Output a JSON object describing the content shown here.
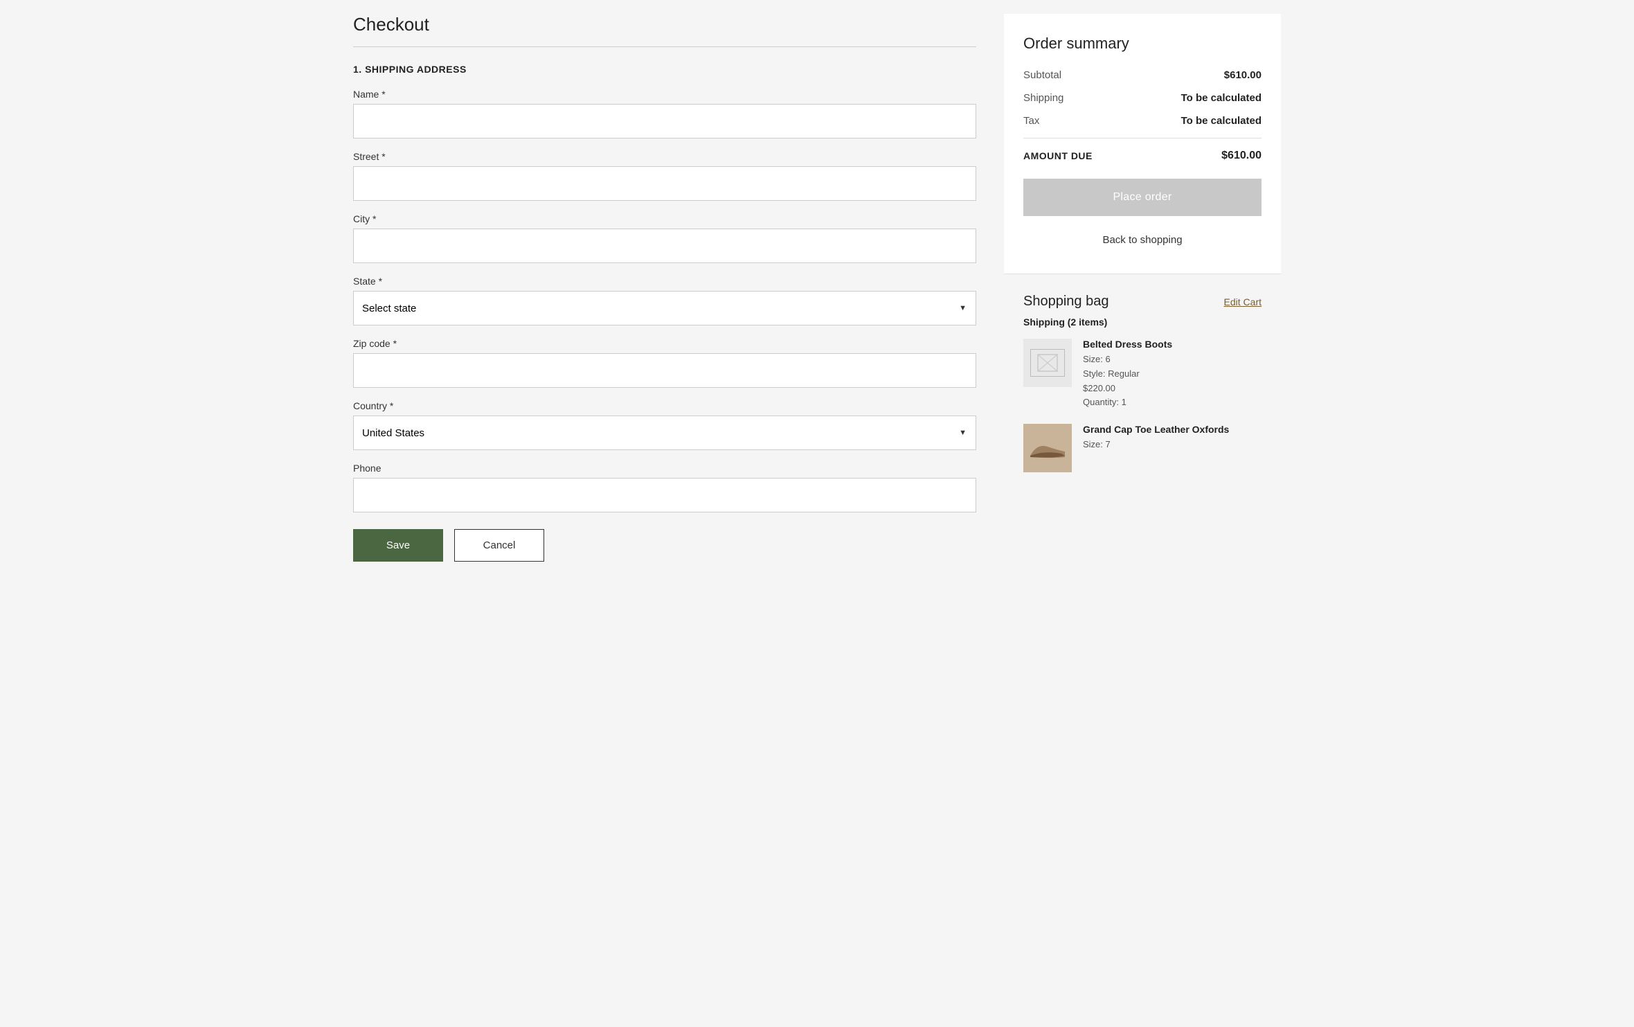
{
  "page": {
    "title": "Checkout"
  },
  "shipping_section": {
    "section_title": "1. SHIPPING ADDRESS",
    "fields": {
      "name": {
        "label": "Name *",
        "placeholder": "",
        "value": ""
      },
      "street": {
        "label": "Street *",
        "placeholder": "",
        "value": ""
      },
      "city": {
        "label": "City *",
        "placeholder": "",
        "value": ""
      },
      "state": {
        "label": "State *",
        "placeholder": "Select state",
        "value": ""
      },
      "zip": {
        "label": "Zip code *",
        "placeholder": "",
        "value": ""
      },
      "country": {
        "label": "Country *",
        "value": "United States"
      },
      "phone": {
        "label": "Phone",
        "placeholder": "",
        "value": ""
      }
    },
    "buttons": {
      "save": "Save",
      "cancel": "Cancel"
    }
  },
  "order_summary": {
    "title": "Order summary",
    "subtotal_label": "Subtotal",
    "subtotal_value": "$610.00",
    "shipping_label": "Shipping",
    "shipping_value": "To be calculated",
    "tax_label": "Tax",
    "tax_value": "To be calculated",
    "amount_due_label": "AMOUNT DUE",
    "amount_due_value": "$610.00",
    "place_order_label": "Place order",
    "back_to_shopping_label": "Back to shopping"
  },
  "shopping_bag": {
    "title": "Shopping bag",
    "edit_cart_label": "Edit Cart",
    "shipping_items_label": "Shipping (2 items)",
    "items": [
      {
        "name": "Belted Dress Boots",
        "size": "Size: 6",
        "style": "Style: Regular",
        "price": "$220.00",
        "quantity": "Quantity: 1",
        "has_placeholder_image": true
      },
      {
        "name": "Grand Cap Toe Leather Oxfords",
        "size": "Size: 7",
        "has_placeholder_image": false
      }
    ]
  }
}
